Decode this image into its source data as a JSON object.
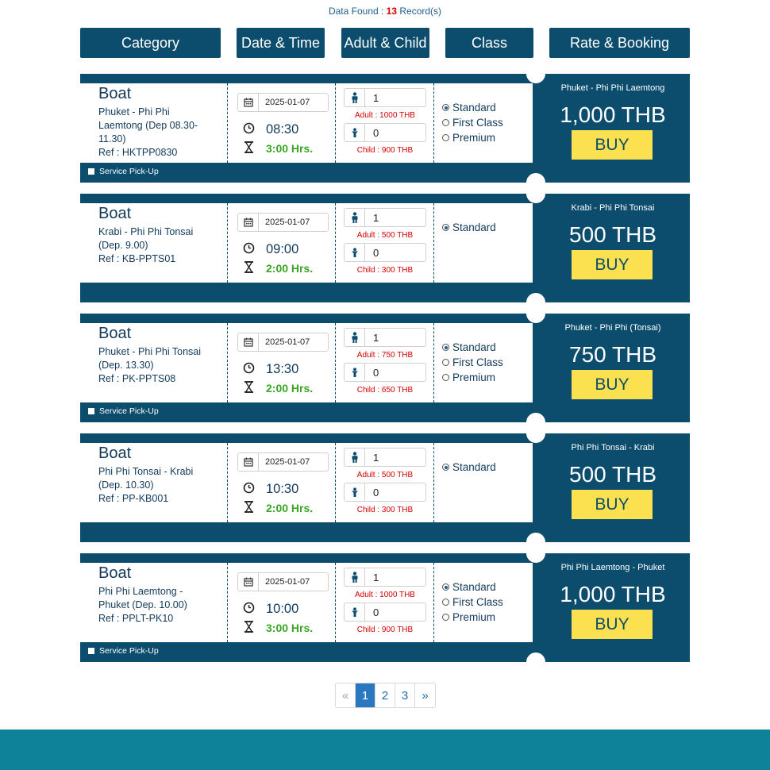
{
  "summary": {
    "prefix": "Data Found : ",
    "count": "13",
    "suffix": " Record(s)"
  },
  "headers": [
    "Category",
    "Date & Time",
    "Adult & Child",
    "Class",
    "Rate & Booking"
  ],
  "cards": [
    {
      "type": "Boat",
      "route_lines": [
        "Phuket - Phi Phi",
        "Laemtong (Dep 08.30-",
        "11.30)"
      ],
      "ref": "Ref : HKTPP0830",
      "date": "2025-01-07",
      "time": "08:30",
      "duration": "3:00 Hrs.",
      "adults": "1",
      "adult_rate": "Adult : 1000 THB",
      "children": "0",
      "child_rate": "Child : 900 THB",
      "classes": [
        "Standard",
        "First Class",
        "Premium"
      ],
      "selected_class": "Standard",
      "pickup_label": "Service Pick-Up",
      "rate_route": "Phuket - Phi Phi Laemtong",
      "price": "1,000 THB",
      "buy_label": "BUY"
    },
    {
      "type": "Boat",
      "route_lines": [
        "Krabi - Phi Phi Tonsai",
        "(Dep. 9.00)"
      ],
      "ref": "Ref : KB-PPTS01",
      "date": "2025-01-07",
      "time": "09:00",
      "duration": "2:00 Hrs.",
      "adults": "1",
      "adult_rate": "Adult : 500 THB",
      "children": "0",
      "child_rate": "Child : 300 THB",
      "classes": [
        "Standard"
      ],
      "selected_class": "Standard",
      "pickup_label": "",
      "rate_route": "Krabi - Phi Phi Tonsai",
      "price": "500 THB",
      "buy_label": "BUY"
    },
    {
      "type": "Boat",
      "route_lines": [
        "Phuket - Phi Phi Tonsai",
        "(Dep. 13.30)"
      ],
      "ref": "Ref : PK-PPTS08",
      "date": "2025-01-07",
      "time": "13:30",
      "duration": "2:00 Hrs.",
      "adults": "1",
      "adult_rate": "Adult : 750 THB",
      "children": "0",
      "child_rate": "Child : 650 THB",
      "classes": [
        "Standard",
        "First Class",
        "Premium"
      ],
      "selected_class": "Standard",
      "pickup_label": "Service Pick-Up",
      "rate_route": "Phuket - Phi Phi (Tonsai)",
      "price": "750 THB",
      "buy_label": "BUY"
    },
    {
      "type": "Boat",
      "route_lines": [
        "Phi Phi Tonsai - Krabi",
        "(Dep. 10.30)"
      ],
      "ref": "Ref : PP-KB001",
      "date": "2025-01-07",
      "time": "10:30",
      "duration": "2:00 Hrs.",
      "adults": "1",
      "adult_rate": "Adult : 500 THB",
      "children": "0",
      "child_rate": "Child : 300 THB",
      "classes": [
        "Standard"
      ],
      "selected_class": "Standard",
      "pickup_label": "",
      "rate_route": "Phi Phi Tonsai - Krabi",
      "price": "500 THB",
      "buy_label": "BUY"
    },
    {
      "type": "Boat",
      "route_lines": [
        "Phi Phi Laemtong -",
        "Phuket (Dep. 10.00)"
      ],
      "ref": "Ref : PPLT-PK10",
      "date": "2025-01-07",
      "time": "10:00",
      "duration": "3:00 Hrs.",
      "adults": "1",
      "adult_rate": "Adult : 1000 THB",
      "children": "0",
      "child_rate": "Child : 900 THB",
      "classes": [
        "Standard",
        "First Class",
        "Premium"
      ],
      "selected_class": "Standard",
      "pickup_label": "Service Pick-Up",
      "rate_route": "Phi Phi Laemtong - Phuket",
      "price": "1,000 THB",
      "buy_label": "BUY"
    }
  ],
  "pagination": {
    "prev": "«",
    "pages": [
      "1",
      "2",
      "3"
    ],
    "active": "1",
    "next": "»"
  },
  "icons": {
    "calendar": "calendar-icon",
    "clock": "clock-icon",
    "hourglass": "hourglass-icon",
    "adult": "adult-icon",
    "child": "child-icon"
  },
  "colors": {
    "primary": "#0c4d6d",
    "buy": "#fbe14f",
    "price_alert": "#d40000",
    "duration": "#3aa524",
    "footer": "#0e8299",
    "pager_active": "#2a79c0"
  }
}
